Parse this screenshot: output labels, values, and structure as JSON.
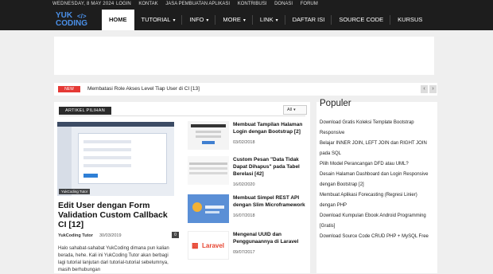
{
  "topbar": {
    "date": "WEDNESDAY, 8 MAY 2024",
    "links": [
      "LOGIN",
      "KONTAK",
      "JASA PEMBUATAN APLIKASI",
      "KONTRIBUSI",
      "DONASI",
      "FORUM"
    ]
  },
  "logo": {
    "line1": "YUK",
    "line2": "CODING",
    "icon": "code-brackets-icon"
  },
  "menu": [
    {
      "label": "HOME",
      "active": true,
      "has_dropdown": false
    },
    {
      "label": "TUTORIAL",
      "active": false,
      "has_dropdown": true
    },
    {
      "label": "INFO",
      "active": false,
      "has_dropdown": true
    },
    {
      "label": "MORE",
      "active": false,
      "has_dropdown": true
    },
    {
      "label": "LINK",
      "active": false,
      "has_dropdown": true
    },
    {
      "label": "DAFTAR ISI",
      "active": false,
      "has_dropdown": false
    },
    {
      "label": "SOURCE CODE",
      "active": false,
      "has_dropdown": false
    },
    {
      "label": "KURSUS",
      "active": false,
      "has_dropdown": false
    }
  ],
  "ticker": {
    "badge": "NEW",
    "text": "Membatasi Role Akses Level Tiap User di CI [13]"
  },
  "section": {
    "tag": "ARTIKEL PILIHAN",
    "filter": "All"
  },
  "featured": {
    "image_caption": "YukCoding Tutor",
    "title": "Edit User dengan Form Validation Custom Callback CI [12]",
    "author": "YukCoding Tutor",
    "date": "30/03/2019",
    "comments": "0",
    "excerpt": "Halo sahabat-sahabat YukCoding dimana pun kalian berada, hehe. Kali ini YukCoding Tutor akan berbagi lagi tutorial lanjutan dari tutorial-tutorial sebelumnya, masih berhubungan"
  },
  "side_posts": [
    {
      "title": "Membuat Tampilan Halaman Login dengan Bootstrap [2]",
      "date": "03/02/2018"
    },
    {
      "title": "Custom Pesan \"Data Tidak Dapat Dihapus\" pada Tabel Berelasi [42]",
      "date": "16/02/2020"
    },
    {
      "title": "Membuat Simpel REST API dengan Slim Microframework",
      "date": "16/07/2018"
    },
    {
      "title": "Mengenal UUID dan Penggunaannya di Laravel",
      "date": "09/07/2017"
    }
  ],
  "thumb_text": {
    "laravel": "Laravel"
  },
  "sidebar": {
    "heading": "Populer",
    "items": [
      "Download Gratis Koleksi Template Bootstrap Responsive",
      "Belajar INNER JOIN, LEFT JOIN dan RIGHT JOIN pada SQL",
      "Pilih Model Perancangan DFD atau UML?",
      "Desain Halaman Dashboard dan Login Responsive dengan Bootstrap [2]",
      "Membuat Aplikasi Forecasting (Regresi Linier) dengan PHP",
      "Download Kumpulan Ebook Android Programming [Gratis]",
      "Download Source Code CRUD PHP + MySQL Free"
    ]
  },
  "colors": {
    "dark": "#1d1d1d",
    "accent_blue": "#4a8fe7",
    "badge_red": "#e53935"
  }
}
